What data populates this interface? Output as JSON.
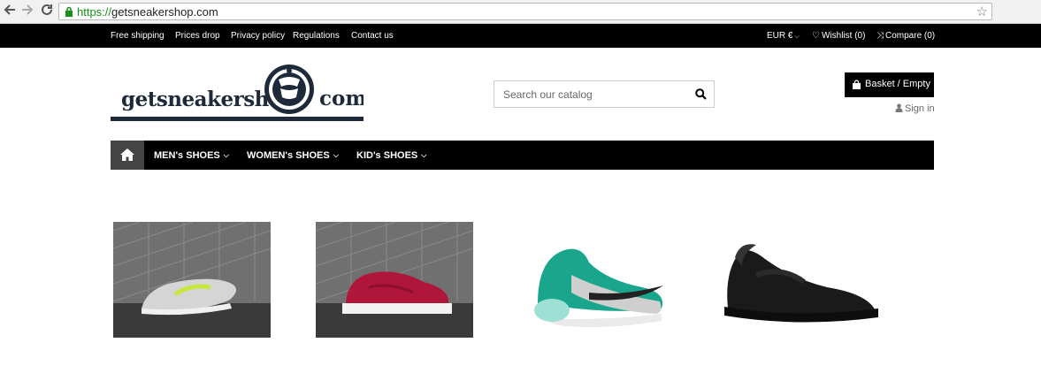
{
  "browser": {
    "url_scheme": "https://",
    "url_host": "getsneakershop.com",
    "back_icon": "arrow-left-icon",
    "forward_icon": "arrow-right-icon",
    "reload_icon": "reload-icon",
    "bookmark_icon": "star-icon"
  },
  "topbar": {
    "links": [
      "Free shipping",
      "Prices drop",
      "Privacy policy",
      "Regulations",
      "Contact us"
    ],
    "currency": "EUR €",
    "wishlist": "Wishlist (0)",
    "compare": "Compare (0)"
  },
  "header": {
    "logo_text_left": "getsneakershop",
    "logo_text_right": "com",
    "search_placeholder": "Search our catalog",
    "basket_label": "Basket / Empty",
    "signin_label": "Sign in"
  },
  "nav": {
    "home_icon": "home-icon",
    "items": [
      "MEN's SHOES",
      "WOMEN's SHOES",
      "KID's SHOES"
    ]
  },
  "products": [
    {
      "name": "grey-green-runner",
      "bg": "#6f6f6f",
      "shoe": "#d8d8d8",
      "accent": "#c8e640"
    },
    {
      "name": "red-low-top",
      "bg": "#6f6f6f",
      "shoe": "#b0163a",
      "accent": "#ffffff"
    },
    {
      "name": "teal-air-max",
      "bg": "#ffffff",
      "shoe": "#1aa68d",
      "accent": "#222222"
    },
    {
      "name": "black-huarache",
      "bg": "#ffffff",
      "shoe": "#1a1a1a",
      "accent": "#2b2b2b"
    }
  ],
  "colors": {
    "topbar_bg": "#000000",
    "nav_bg": "#000000",
    "home_bg": "#444444",
    "url_green": "#1a8f1a"
  }
}
